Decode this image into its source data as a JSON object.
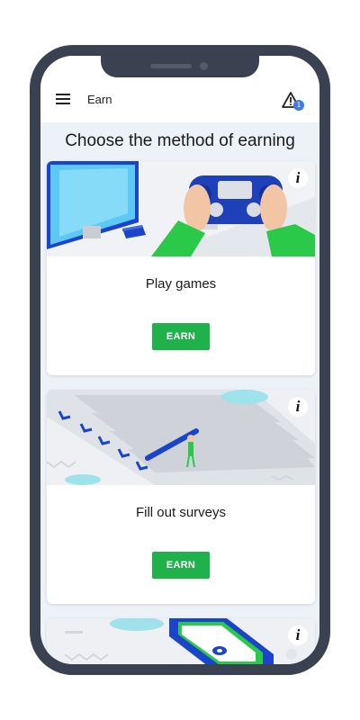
{
  "appbar": {
    "title": "Earn",
    "alert_count": "1"
  },
  "heading": "Choose the method of earning",
  "cards": [
    {
      "title": "Play games",
      "button": "EARN",
      "info": "i"
    },
    {
      "title": "Fill out surveys",
      "button": "EARN",
      "info": "i"
    },
    {
      "info": "i"
    }
  ],
  "colors": {
    "accent": "#1fb14a",
    "badge": "#3f7be8",
    "frame": "#3a4150",
    "background": "#edf2f8"
  },
  "icons": [
    "menu-icon",
    "alert-triangle-icon",
    "info-icon"
  ]
}
